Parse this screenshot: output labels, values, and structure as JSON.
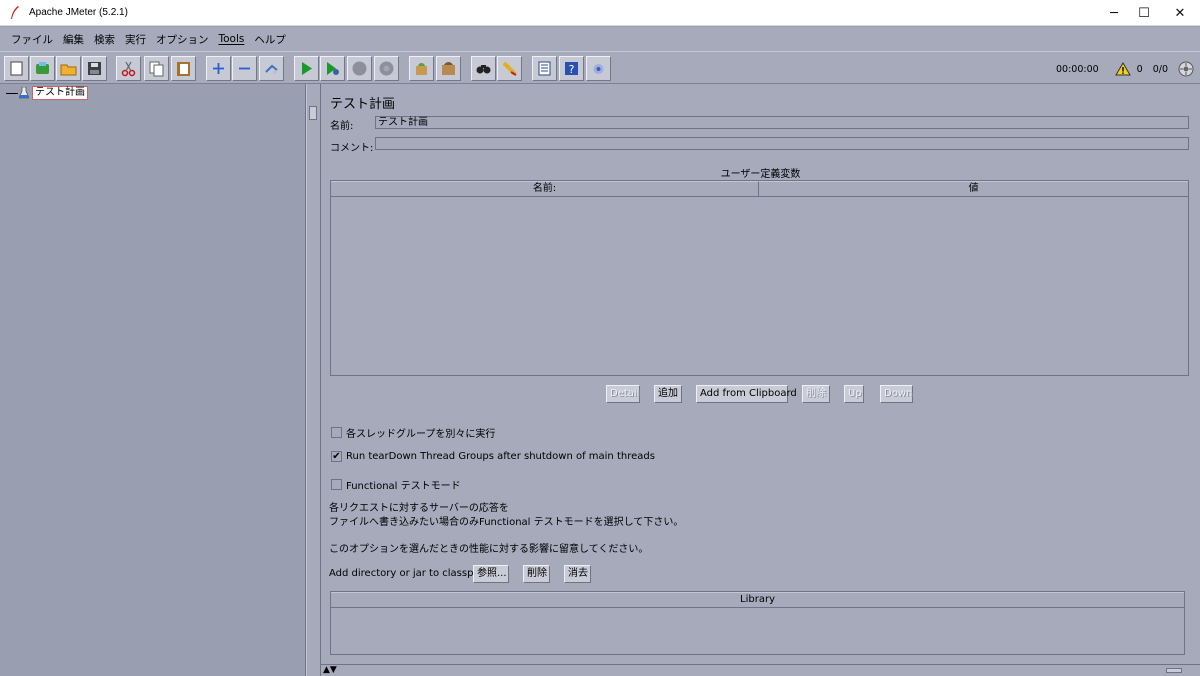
{
  "window": {
    "title": "Apache JMeter (5.2.1)"
  },
  "window_controls": {
    "minimize": "─",
    "maximize": "☐",
    "close": "✕"
  },
  "menu": [
    {
      "label": "ファイル"
    },
    {
      "label": "編集"
    },
    {
      "label": "検索"
    },
    {
      "label": "実行"
    },
    {
      "label": "オプション"
    },
    {
      "label": "Tools"
    },
    {
      "label": "ヘルプ"
    }
  ],
  "toolbar": {
    "buttons": [
      {
        "icon": "new-icon"
      },
      {
        "icon": "templates-icon"
      },
      {
        "icon": "open-icon"
      },
      {
        "icon": "save-icon"
      },
      {
        "icon": "cut-icon"
      },
      {
        "icon": "copy-icon"
      },
      {
        "icon": "paste-icon"
      },
      {
        "icon": "expand-icon"
      },
      {
        "icon": "collapse-icon"
      },
      {
        "icon": "toggle-icon"
      },
      {
        "icon": "start-icon"
      },
      {
        "icon": "start-no-pause-icon"
      },
      {
        "icon": "stop-icon"
      },
      {
        "icon": "shutdown-icon"
      },
      {
        "icon": "clear-icon"
      },
      {
        "icon": "clear-all-icon"
      },
      {
        "icon": "search-icon"
      },
      {
        "icon": "reset-search-icon"
      },
      {
        "icon": "function-helper-icon"
      },
      {
        "icon": "help-icon"
      },
      {
        "icon": "remote-icon"
      }
    ],
    "timer": "00:00:00",
    "warning_count": "0",
    "threads": "0/0"
  },
  "tree": {
    "root_label": "テスト計画"
  },
  "panel": {
    "title": "テスト計画",
    "name_label": "名前:",
    "name_value": "テスト計画",
    "comment_label": "コメント:",
    "comment_value": "",
    "variables_title": "ユーザー定義変数",
    "variables_columns": [
      "名前:",
      "値"
    ],
    "variables_buttons": {
      "detail": "Detail",
      "add": "追加",
      "add_clipboard": "Add from Clipboard",
      "delete": "削除",
      "up": "Up",
      "down": "Down"
    },
    "options": {
      "run_groups_consecutively": {
        "label": "各スレッドグループを別々に実行",
        "checked": false
      },
      "teardown_after_shutdown": {
        "label": "Run tearDown Thread Groups after shutdown of main threads",
        "checked": true
      },
      "functional_mode": {
        "label": "Functional テストモード",
        "checked": false
      }
    },
    "functional_note_1": "各リクエストに対するサーバーの応答を",
    "functional_note_2": "ファイルへ書き込みたい場合のみFunctional テストモードを選択して下さい。",
    "functional_note_3": "このオプションを選んだときの性能に対する影響に留意してください。",
    "classpath_label": "Add directory or jar to classpath",
    "classpath_buttons": {
      "browse": "参照...",
      "delete": "削除",
      "clear": "消去"
    },
    "library_column": "Library"
  },
  "colors": {
    "background": "#a6aabb",
    "tree_background": "#9a9eb1",
    "selected_border": "#c86464"
  }
}
